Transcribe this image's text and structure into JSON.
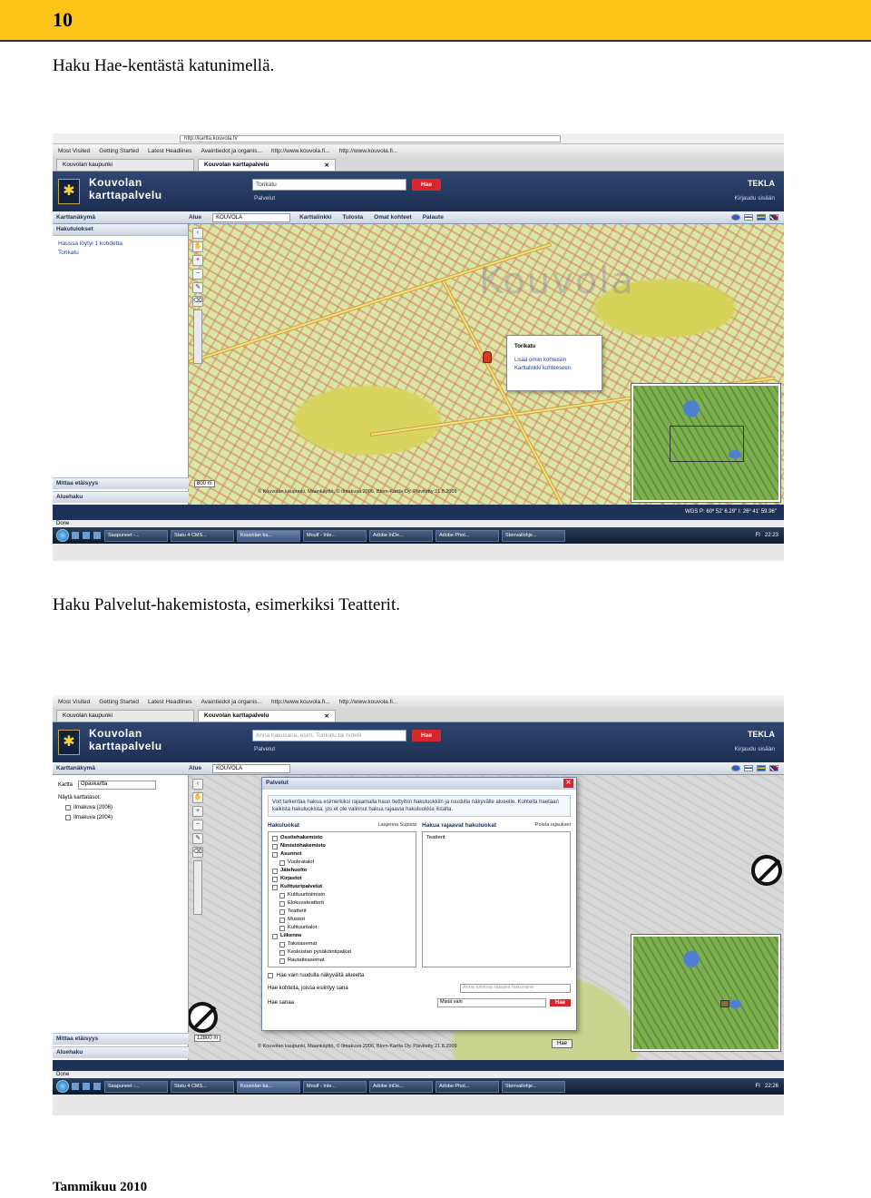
{
  "page": {
    "number": "10",
    "caption_top": "Haku Hae-kentästä katunimellä.",
    "caption_middle": "Haku Palvelut-hakemistosta, esimerkiksi Teatterit.",
    "footer": "Tammikuu 2010"
  },
  "colors": {
    "header_band": "#fdc51a",
    "app_blue": "#1e3258",
    "hae_red": "#d7262c"
  },
  "browser": {
    "address": "http://kartta.kouvola.fi/",
    "bookmarks": [
      "Most Visited",
      "Getting Started",
      "Latest Headlines",
      "Avaintiedot ja organis...",
      "http://www.kouvola.fi...",
      "http://www.kouvola.fi..."
    ],
    "tabs": [
      "Kouvolan kaupunki",
      "Kouvolan karttapalvelu"
    ],
    "done": "Done",
    "taskbar_items": [
      "Saapuneet -...",
      "Statu 4 CMS...",
      "Kouvolan ka...",
      "Moulf - Inte...",
      "Adobe InDe...",
      "Adobe Phot...",
      "Stenvallohje..."
    ],
    "lang": "FI",
    "time1": "22:23",
    "time2": "22:26"
  },
  "app": {
    "logo_line1": "Kouvolan",
    "logo_line2": "karttapalvelu",
    "search_value": "Torikatu",
    "search_placeholder": "Anna hakusana, esim. Torikatu tai hotelli",
    "hae": "Hae",
    "palvelut": "Palvelut",
    "tekla": "TEKLA",
    "login": "Kirjaudu sisään",
    "left_heading": "Karttanäkymä",
    "menu_alue": "Alue",
    "menu_alue_value": "KOUVOLA",
    "menu_items": [
      "Karttalinkki",
      "Tulosta",
      "Omat kohteet",
      "Palaute"
    ],
    "mittaa": "Mittaa etäisyys",
    "aluehaku": "Aluehaku"
  },
  "shot1": {
    "results_heading": "Hakutulokset",
    "results_found": "Haussa löytyi 1 kohdetta.",
    "result_item": "Torikatu",
    "watermark": "Kouvola",
    "scale": "800 m",
    "copyright": "© Kouvolan kaupunki, Maankäyttö, © Ilmakuva 2006, Blom-Kartta Oy. Päivitetty 21.8.2009",
    "popup_title": "Torikatu",
    "popup_link1": "Lisää omiin kohteisiin",
    "popup_link2": "Karttalinkki kohteeseen",
    "coords": "WGS P: 60º 52' 6.29\" I: 26º 41' 59.96\""
  },
  "shot2": {
    "kartta_label": "Kartta",
    "kartta_value": "Opaskartta",
    "layers_label": "Näytä karttatasot:",
    "layers": [
      "Ilmakuva (2006)",
      "Ilmakuva (2004)"
    ],
    "scale": "12800 m",
    "copyright": "© Kouvolan kaupunki, Maankäyttö, © Ilmakuva 2006, Blom-Kartta Oy. Päivitetty 21.8.2009",
    "dialog": {
      "title": "Palvelut",
      "info": "Voit tarkentaa hakua esimerkiksi rajaamalla haun tiettyihin hakuluokkiin ja ruudulla näkyvälle alueelle. Kohteita haetaan kaikista hakuluokista, jos et ole valinnut hakua rajaavia hakuluokkia listalta.",
      "col1_title": "Hakuluokat",
      "col1_action": "Laajenna Supista",
      "col2_title": "Hakua rajaavat hakuluokat",
      "col2_action": "Poista rajaukset",
      "categories": [
        {
          "label": "Osoitehakemisto",
          "level": 0
        },
        {
          "label": "Nimistöhakemisto",
          "level": 0
        },
        {
          "label": "Asunnot",
          "level": 0
        },
        {
          "label": "Vuokratalot",
          "level": 1
        },
        {
          "label": "Jätehuolto",
          "level": 0
        },
        {
          "label": "Kirjastot",
          "level": 0
        },
        {
          "label": "Kulttuuripalvelut",
          "level": 0
        },
        {
          "label": "Kulttuuritoimisto",
          "level": 1
        },
        {
          "label": "Elokuvateatterit",
          "level": 1
        },
        {
          "label": "Teatterit",
          "level": 1
        },
        {
          "label": "Museot",
          "level": 1
        },
        {
          "label": "Kulttuuritalot",
          "level": 1
        },
        {
          "label": "Liikenne",
          "level": 0
        },
        {
          "label": "Taksiasemat",
          "level": 1
        },
        {
          "label": "Keskustan pysäköintipaikat",
          "level": 1
        },
        {
          "label": "Rautatieasemat",
          "level": 1
        }
      ],
      "selected": [
        "Teatterit"
      ],
      "visible_only": "Hae vain ruudulla näkyvältä alueelta",
      "hae_kohteita": "Hae kohteita, joissa esiintyy sana",
      "filter_placeholder": "Anna tuloksia rajaava hakusana",
      "hae_sanaa": "Hae sanaa",
      "match_value": "Mistä vain",
      "hae": "Hae",
      "hae_secondary": "Hae"
    }
  }
}
